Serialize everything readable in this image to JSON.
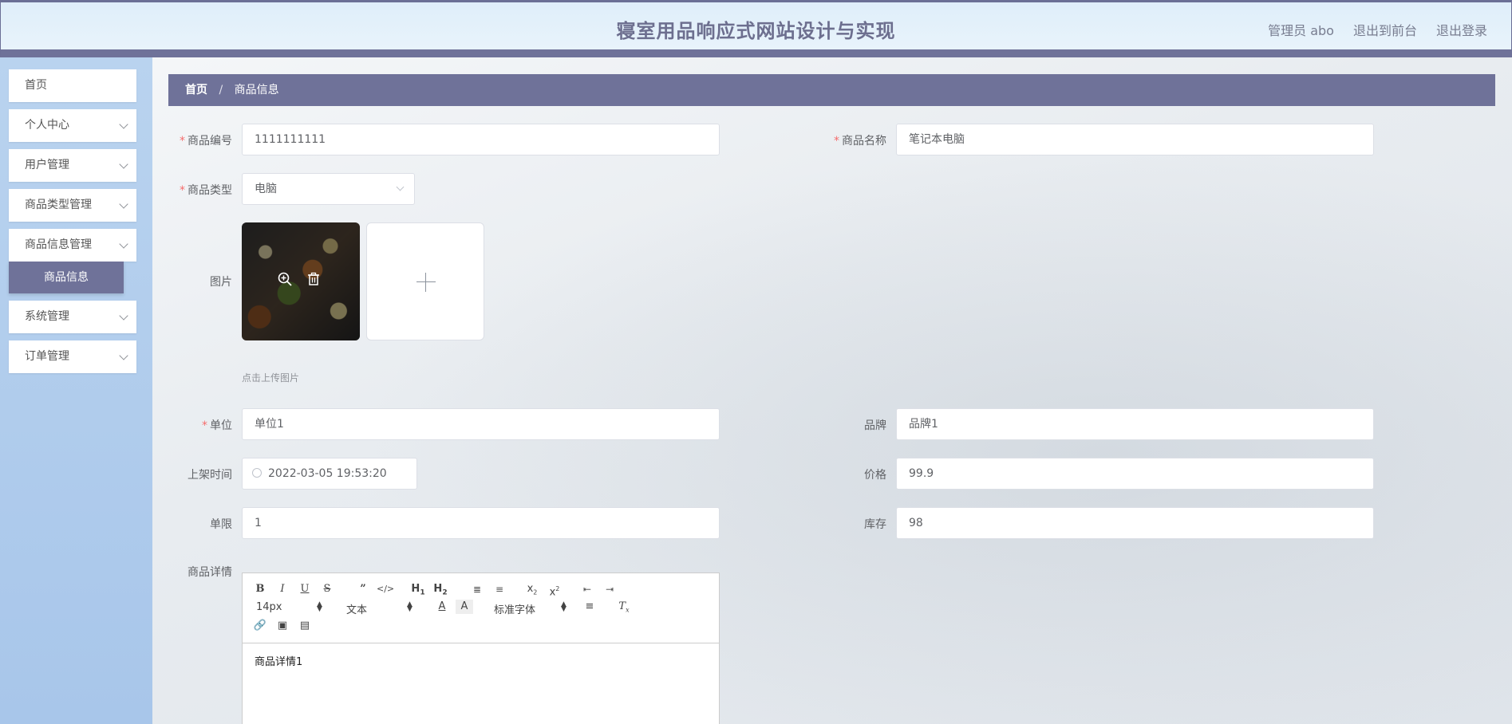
{
  "header": {
    "title": "寝室用品响应式网站设计与实现",
    "user": "管理员 abo",
    "to_front": "退出到前台",
    "logout": "退出登录"
  },
  "sidebar": {
    "items": [
      {
        "label": "首页",
        "has_children": false
      },
      {
        "label": "个人中心",
        "has_children": true
      },
      {
        "label": "用户管理",
        "has_children": true
      },
      {
        "label": "商品类型管理",
        "has_children": true
      },
      {
        "label": "商品信息管理",
        "has_children": true
      },
      {
        "label": "系统管理",
        "has_children": true
      },
      {
        "label": "订单管理",
        "has_children": true
      }
    ],
    "active_sub": "商品信息"
  },
  "breadcrumb": {
    "home": "首页",
    "separator": "/",
    "current": "商品信息"
  },
  "form": {
    "code": {
      "label": "商品编号",
      "value": "1111111111"
    },
    "name": {
      "label": "商品名称",
      "value": "笔记本电脑"
    },
    "type": {
      "label": "商品类型",
      "value": "电脑"
    },
    "image": {
      "label": "图片",
      "hint": "点击上传图片"
    },
    "unit": {
      "label": "单位",
      "value": "单位1"
    },
    "brand": {
      "label": "品牌",
      "value": "品牌1"
    },
    "listing_time": {
      "label": "上架时间",
      "value": "2022-03-05 19:53:20"
    },
    "price": {
      "label": "价格",
      "value": "99.9"
    },
    "limit": {
      "label": "单限",
      "value": "1"
    },
    "stock": {
      "label": "库存",
      "value": "98"
    },
    "detail": {
      "label": "商品详情",
      "value": "商品详情1"
    }
  },
  "editor": {
    "size": "14px",
    "format": "文本",
    "font": "标准字体"
  },
  "colors": {
    "accent": "#6f7299",
    "required": "#f56c6c"
  }
}
